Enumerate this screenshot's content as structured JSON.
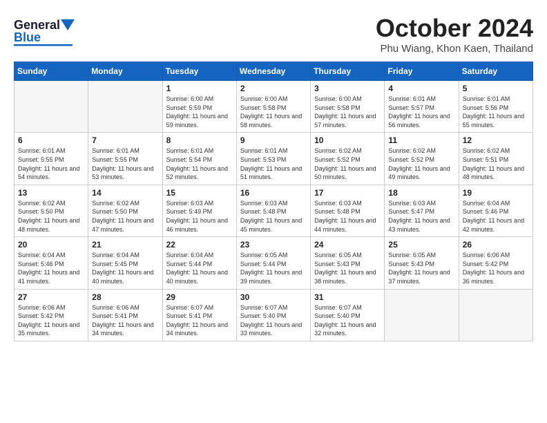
{
  "header": {
    "logo_general": "General",
    "logo_blue": "Blue",
    "month_year": "October 2024",
    "location": "Phu Wiang, Khon Kaen, Thailand"
  },
  "days_of_week": [
    "Sunday",
    "Monday",
    "Tuesday",
    "Wednesday",
    "Thursday",
    "Friday",
    "Saturday"
  ],
  "weeks": [
    [
      {
        "day": "",
        "empty": true
      },
      {
        "day": "",
        "empty": true
      },
      {
        "day": "1",
        "sunrise": "6:00 AM",
        "sunset": "5:59 PM",
        "daylight": "11 hours and 59 minutes."
      },
      {
        "day": "2",
        "sunrise": "6:00 AM",
        "sunset": "5:58 PM",
        "daylight": "11 hours and 58 minutes."
      },
      {
        "day": "3",
        "sunrise": "6:00 AM",
        "sunset": "5:58 PM",
        "daylight": "11 hours and 57 minutes."
      },
      {
        "day": "4",
        "sunrise": "6:01 AM",
        "sunset": "5:57 PM",
        "daylight": "11 hours and 56 minutes."
      },
      {
        "day": "5",
        "sunrise": "6:01 AM",
        "sunset": "5:56 PM",
        "daylight": "11 hours and 55 minutes."
      }
    ],
    [
      {
        "day": "6",
        "sunrise": "6:01 AM",
        "sunset": "5:55 PM",
        "daylight": "11 hours and 54 minutes."
      },
      {
        "day": "7",
        "sunrise": "6:01 AM",
        "sunset": "5:55 PM",
        "daylight": "11 hours and 53 minutes."
      },
      {
        "day": "8",
        "sunrise": "6:01 AM",
        "sunset": "5:54 PM",
        "daylight": "11 hours and 52 minutes."
      },
      {
        "day": "9",
        "sunrise": "6:01 AM",
        "sunset": "5:53 PM",
        "daylight": "11 hours and 51 minutes."
      },
      {
        "day": "10",
        "sunrise": "6:02 AM",
        "sunset": "5:52 PM",
        "daylight": "11 hours and 50 minutes."
      },
      {
        "day": "11",
        "sunrise": "6:02 AM",
        "sunset": "5:52 PM",
        "daylight": "11 hours and 49 minutes."
      },
      {
        "day": "12",
        "sunrise": "6:02 AM",
        "sunset": "5:51 PM",
        "daylight": "11 hours and 48 minutes."
      }
    ],
    [
      {
        "day": "13",
        "sunrise": "6:02 AM",
        "sunset": "5:50 PM",
        "daylight": "11 hours and 48 minutes."
      },
      {
        "day": "14",
        "sunrise": "6:02 AM",
        "sunset": "5:50 PM",
        "daylight": "11 hours and 47 minutes."
      },
      {
        "day": "15",
        "sunrise": "6:03 AM",
        "sunset": "5:49 PM",
        "daylight": "11 hours and 46 minutes."
      },
      {
        "day": "16",
        "sunrise": "6:03 AM",
        "sunset": "5:48 PM",
        "daylight": "11 hours and 45 minutes."
      },
      {
        "day": "17",
        "sunrise": "6:03 AM",
        "sunset": "5:48 PM",
        "daylight": "11 hours and 44 minutes."
      },
      {
        "day": "18",
        "sunrise": "6:03 AM",
        "sunset": "5:47 PM",
        "daylight": "11 hours and 43 minutes."
      },
      {
        "day": "19",
        "sunrise": "6:04 AM",
        "sunset": "5:46 PM",
        "daylight": "11 hours and 42 minutes."
      }
    ],
    [
      {
        "day": "20",
        "sunrise": "6:04 AM",
        "sunset": "5:46 PM",
        "daylight": "11 hours and 41 minutes."
      },
      {
        "day": "21",
        "sunrise": "6:04 AM",
        "sunset": "5:45 PM",
        "daylight": "11 hours and 40 minutes."
      },
      {
        "day": "22",
        "sunrise": "6:04 AM",
        "sunset": "5:44 PM",
        "daylight": "11 hours and 40 minutes."
      },
      {
        "day": "23",
        "sunrise": "6:05 AM",
        "sunset": "5:44 PM",
        "daylight": "11 hours and 39 minutes."
      },
      {
        "day": "24",
        "sunrise": "6:05 AM",
        "sunset": "5:43 PM",
        "daylight": "11 hours and 38 minutes."
      },
      {
        "day": "25",
        "sunrise": "6:05 AM",
        "sunset": "5:43 PM",
        "daylight": "11 hours and 37 minutes."
      },
      {
        "day": "26",
        "sunrise": "6:06 AM",
        "sunset": "5:42 PM",
        "daylight": "11 hours and 36 minutes."
      }
    ],
    [
      {
        "day": "27",
        "sunrise": "6:06 AM",
        "sunset": "5:42 PM",
        "daylight": "11 hours and 35 minutes."
      },
      {
        "day": "28",
        "sunrise": "6:06 AM",
        "sunset": "5:41 PM",
        "daylight": "11 hours and 34 minutes."
      },
      {
        "day": "29",
        "sunrise": "6:07 AM",
        "sunset": "5:41 PM",
        "daylight": "11 hours and 34 minutes."
      },
      {
        "day": "30",
        "sunrise": "6:07 AM",
        "sunset": "5:40 PM",
        "daylight": "11 hours and 33 minutes."
      },
      {
        "day": "31",
        "sunrise": "6:07 AM",
        "sunset": "5:40 PM",
        "daylight": "11 hours and 32 minutes."
      },
      {
        "day": "",
        "empty": true
      },
      {
        "day": "",
        "empty": true
      }
    ]
  ],
  "labels": {
    "sunrise_prefix": "Sunrise: ",
    "sunset_prefix": "Sunset: ",
    "daylight_prefix": "Daylight: "
  }
}
